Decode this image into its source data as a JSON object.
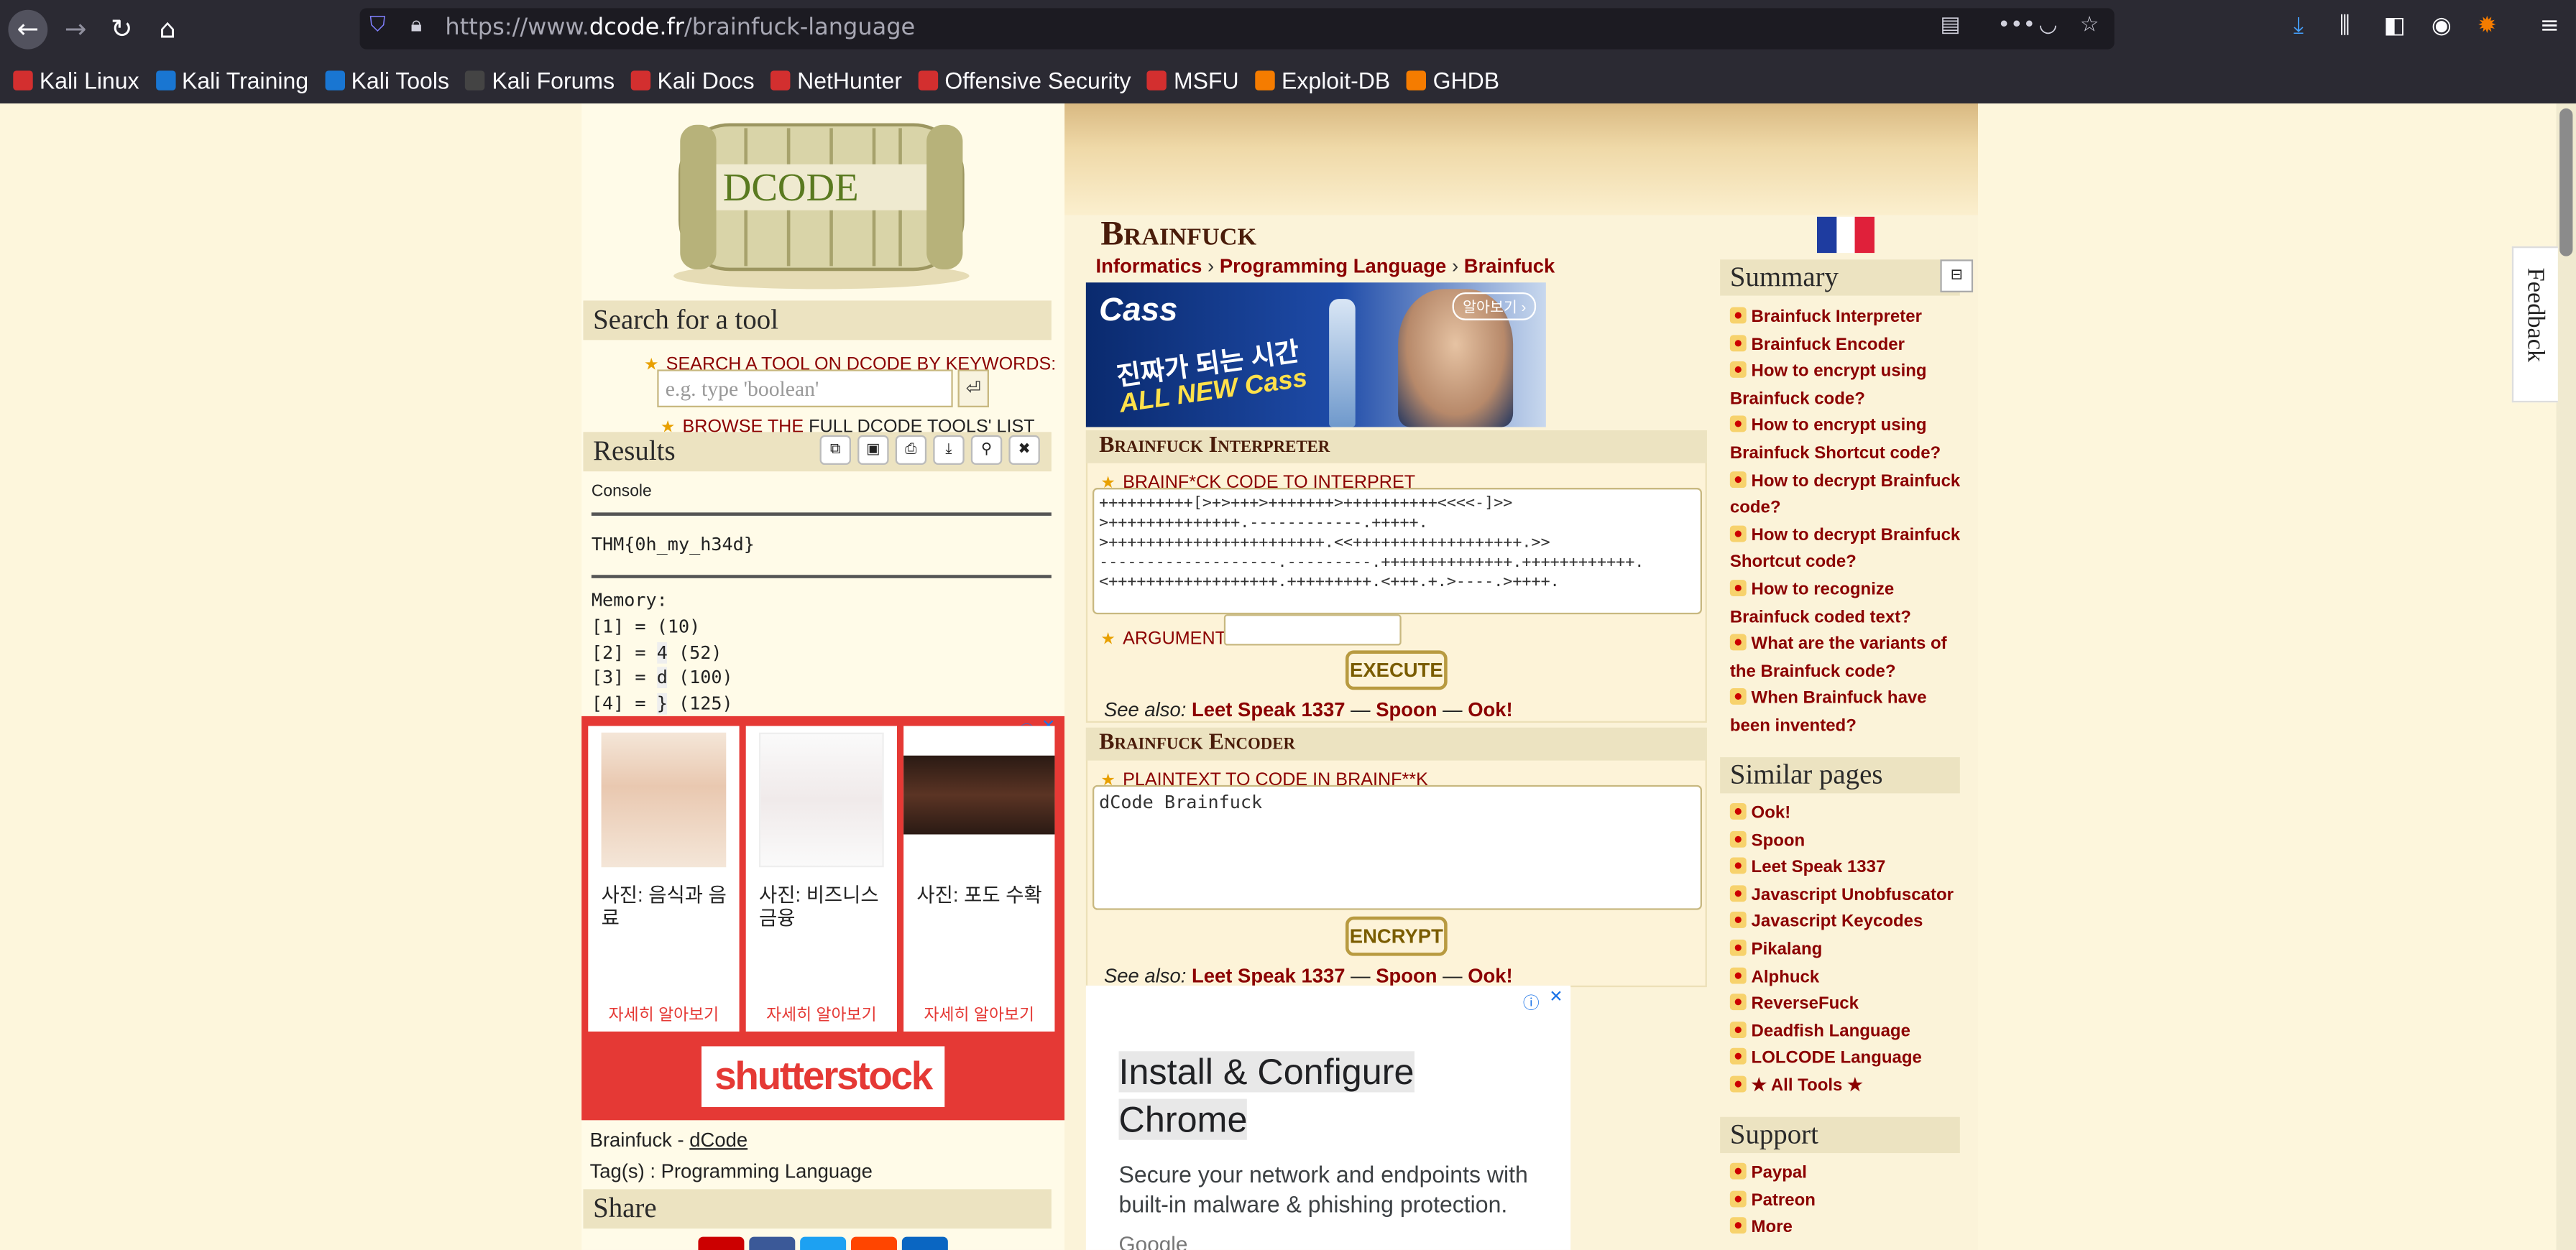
{
  "browser": {
    "url_prefix": "https://www.",
    "url_domain": "dcode.fr",
    "url_path": "/brainfuck-language",
    "back_icon": "back-arrow-icon",
    "forward_icon": "forward-arrow-icon",
    "reload_icon": "reload-icon",
    "home_icon": "home-icon"
  },
  "bookmarks": [
    {
      "label": "Kali Linux",
      "color": "#d32f2f"
    },
    {
      "label": "Kali Training",
      "color": "#1976d2"
    },
    {
      "label": "Kali Tools",
      "color": "#1976d2"
    },
    {
      "label": "Kali Forums",
      "color": "#444444"
    },
    {
      "label": "Kali Docs",
      "color": "#d32f2f"
    },
    {
      "label": "NetHunter",
      "color": "#d32f2f"
    },
    {
      "label": "Offensive Security",
      "color": "#d32f2f"
    },
    {
      "label": "MSFU",
      "color": "#d32f2f"
    },
    {
      "label": "Exploit-DB",
      "color": "#f57c00"
    },
    {
      "label": "GHDB",
      "color": "#f57c00"
    }
  ],
  "left": {
    "logo_text": "DCODE",
    "search_header": "Search for a tool",
    "search_label": "SEARCH A TOOL ON DCODE BY KEYWORDS:",
    "search_placeholder": "e.g. type 'boolean'",
    "browse_prefix": "BROWSE THE ",
    "browse_link": "FULL DCODE TOOLS' LIST",
    "results_header": "Results",
    "console_label": "Console",
    "console_output": "THM{0h_my_h34d}",
    "memory_label": "Memory:",
    "memory": [
      {
        "idx": "[1] = ",
        "char": " ",
        "code": "(10)"
      },
      {
        "idx": "[2] = ",
        "char": "4",
        "code": "(52)"
      },
      {
        "idx": "[3] = ",
        "char": "d",
        "code": "(100)"
      },
      {
        "idx": "[4] = ",
        "char": "}",
        "code": "(125)"
      }
    ],
    "ads": [
      {
        "caption": "사진: 음식과 음료",
        "more": "자세히 알아보기"
      },
      {
        "caption": "사진: 비즈니스 금융",
        "more": "자세히 알아보기"
      },
      {
        "caption": "사진: 포도 수확",
        "more": "자세히 알아보기"
      }
    ],
    "ad_brand": "shutterstock",
    "footer_title": "Brainfuck - ",
    "footer_link": "dCode",
    "tags": "Tag(s) : Programming Language",
    "share_header": "Share"
  },
  "main": {
    "title": "Brainfuck",
    "breadcrumbs": [
      "Informatics",
      "Programming Language",
      "Brainfuck"
    ],
    "banner": {
      "brand": "Cass",
      "line1": "진짜가 되는 시간",
      "line2": "ALL NEW Cass",
      "cta": "알아보기 ›"
    },
    "interpreter": {
      "header": "Brainfuck Interpreter",
      "code_label": "BRAINF*CK CODE TO INTERPRET",
      "code": "++++++++++[>+>+++>+++++++>++++++++++<<<<-]>>\n>++++++++++++++.------------.+++++.\n>+++++++++++++++++++++++.<<++++++++++++++++++.>>\n-------------------.---------.++++++++++++++.++++++++++++.\n<++++++++++++++++++.+++++++++.<+++.+.>----.>++++.",
      "argument_label": "ARGUMENT",
      "execute": "EXECUTE",
      "see_also": "See also:",
      "links": [
        "Leet Speak 1337",
        "Spoon",
        "Ook!"
      ]
    },
    "encoder": {
      "header": "Brainfuck Encoder",
      "label": "PLAINTEXT TO CODE IN BRAINF**K",
      "value": "dCode Brainfuck",
      "encrypt": "ENCRYPT",
      "see_also": "See also:",
      "links": [
        "Leet Speak 1337",
        "Spoon",
        "Ook!"
      ]
    },
    "google_ad": {
      "title_line1": "Install & Configure",
      "title_line2": "Chrome",
      "body": "Secure your network and endpoints with built-in malware & phishing protection.",
      "footer": "Google"
    }
  },
  "right": {
    "summary_header": "Summary",
    "summary": [
      "Brainfuck Interpreter",
      "Brainfuck Encoder",
      "How to encrypt using Brainfuck code?",
      "How to encrypt using Brainfuck Shortcut code?",
      "How to decrypt Brainfuck code?",
      "How to decrypt Brainfuck Shortcut code?",
      "How to recognize Brainfuck coded text?",
      "What are the variants of the Brainfuck code?",
      "When Brainfuck have been invented?"
    ],
    "similar_header": "Similar pages",
    "similar": [
      "Ook!",
      "Spoon",
      "Leet Speak 1337",
      "Javascript Unobfuscator",
      "Javascript Keycodes",
      "Pikalang",
      "Alphuck",
      "ReverseFuck",
      "Deadfish Language",
      "LOLCODE Language",
      "★ All Tools ★"
    ],
    "support_header": "Support",
    "support": [
      "Paypal",
      "Patreon",
      "More"
    ],
    "feedback": "Feedback"
  }
}
